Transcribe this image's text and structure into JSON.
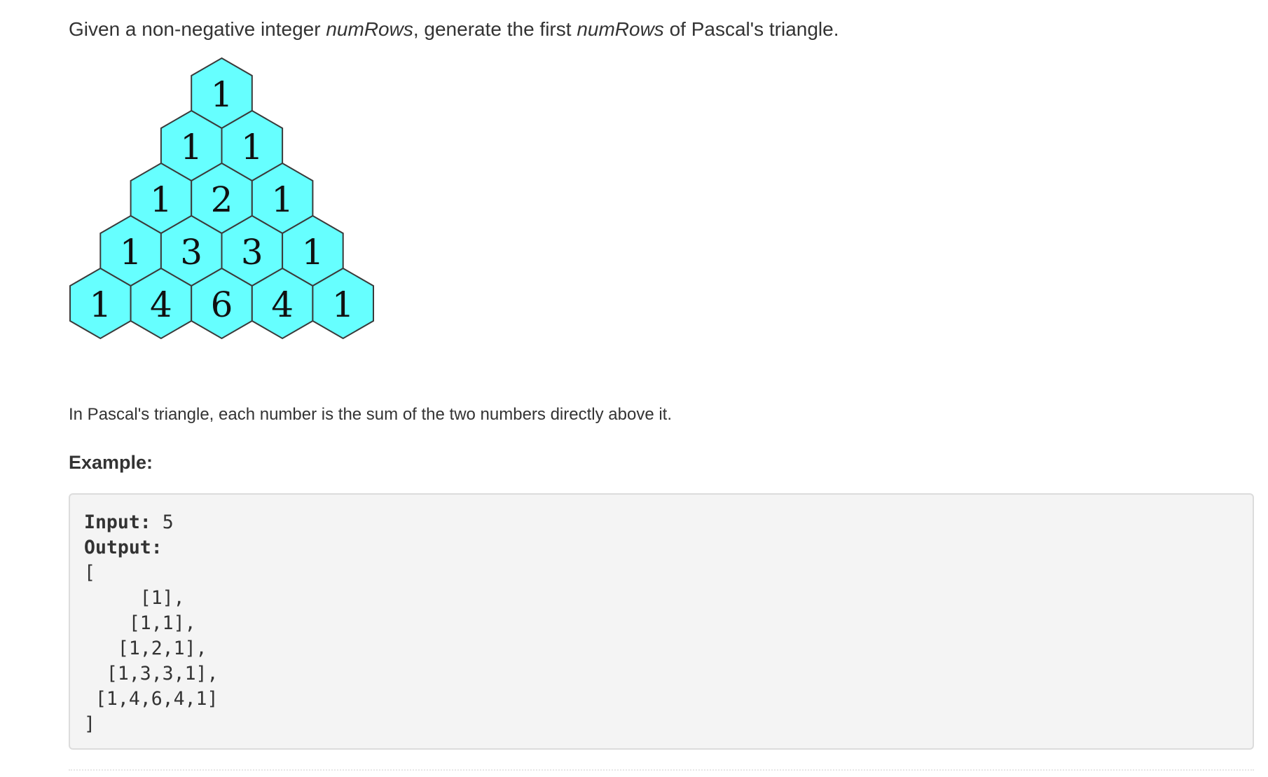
{
  "problem": {
    "statement": {
      "part1": "Given a non-negative integer ",
      "var1": "numRows",
      "part2": ", generate the first ",
      "var2": "numRows",
      "part3": " of Pascal's triangle."
    },
    "triangle": {
      "rows": [
        [
          "1"
        ],
        [
          "1",
          "1"
        ],
        [
          "1",
          "2",
          "1"
        ],
        [
          "1",
          "3",
          "3",
          "1"
        ],
        [
          "1",
          "4",
          "6",
          "4",
          "1"
        ]
      ],
      "cell_color": "#66ffff",
      "border_color": "#3a3a3a"
    },
    "explanation": "In Pascal's triangle, each number is the sum of the two numbers directly above it.",
    "example_heading": "Example:",
    "example": {
      "input_key": "Input:",
      "input_value": " 5",
      "output_key": "Output:",
      "output_lines": [
        "[",
        "     [1],",
        "    [1,1],",
        "   [1,2,1],",
        "  [1,3,3,1],",
        " [1,4,6,4,1]",
        "]"
      ]
    }
  }
}
